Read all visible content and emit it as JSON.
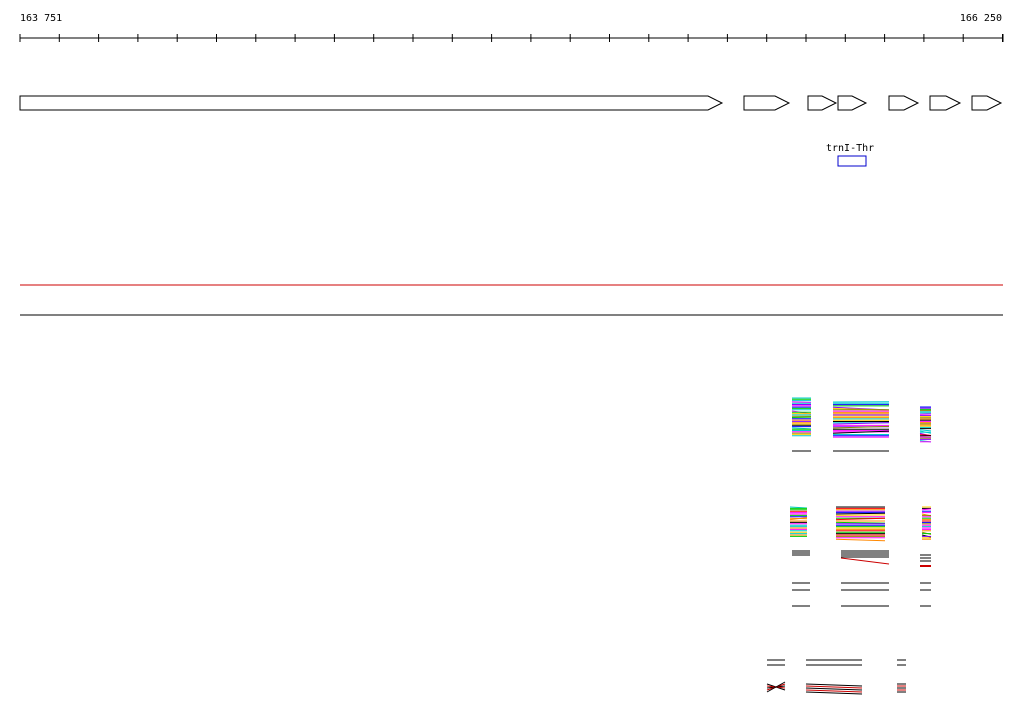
{
  "ruler": {
    "start_label": "163 751",
    "end_label": "166 250"
  },
  "features": [
    {
      "name": "trnI-Thr",
      "color": "#0000cc"
    }
  ],
  "colors": {
    "reference_line": "#cc0000",
    "axis_line": "#000000",
    "gene_outline": "#000000",
    "read_palette": [
      "#ff00ff",
      "#00cc00",
      "#0000ff",
      "#ff8800",
      "#00cccc",
      "#ff0000",
      "#888800",
      "#8800ff",
      "#000000",
      "#ffcc00"
    ]
  }
}
